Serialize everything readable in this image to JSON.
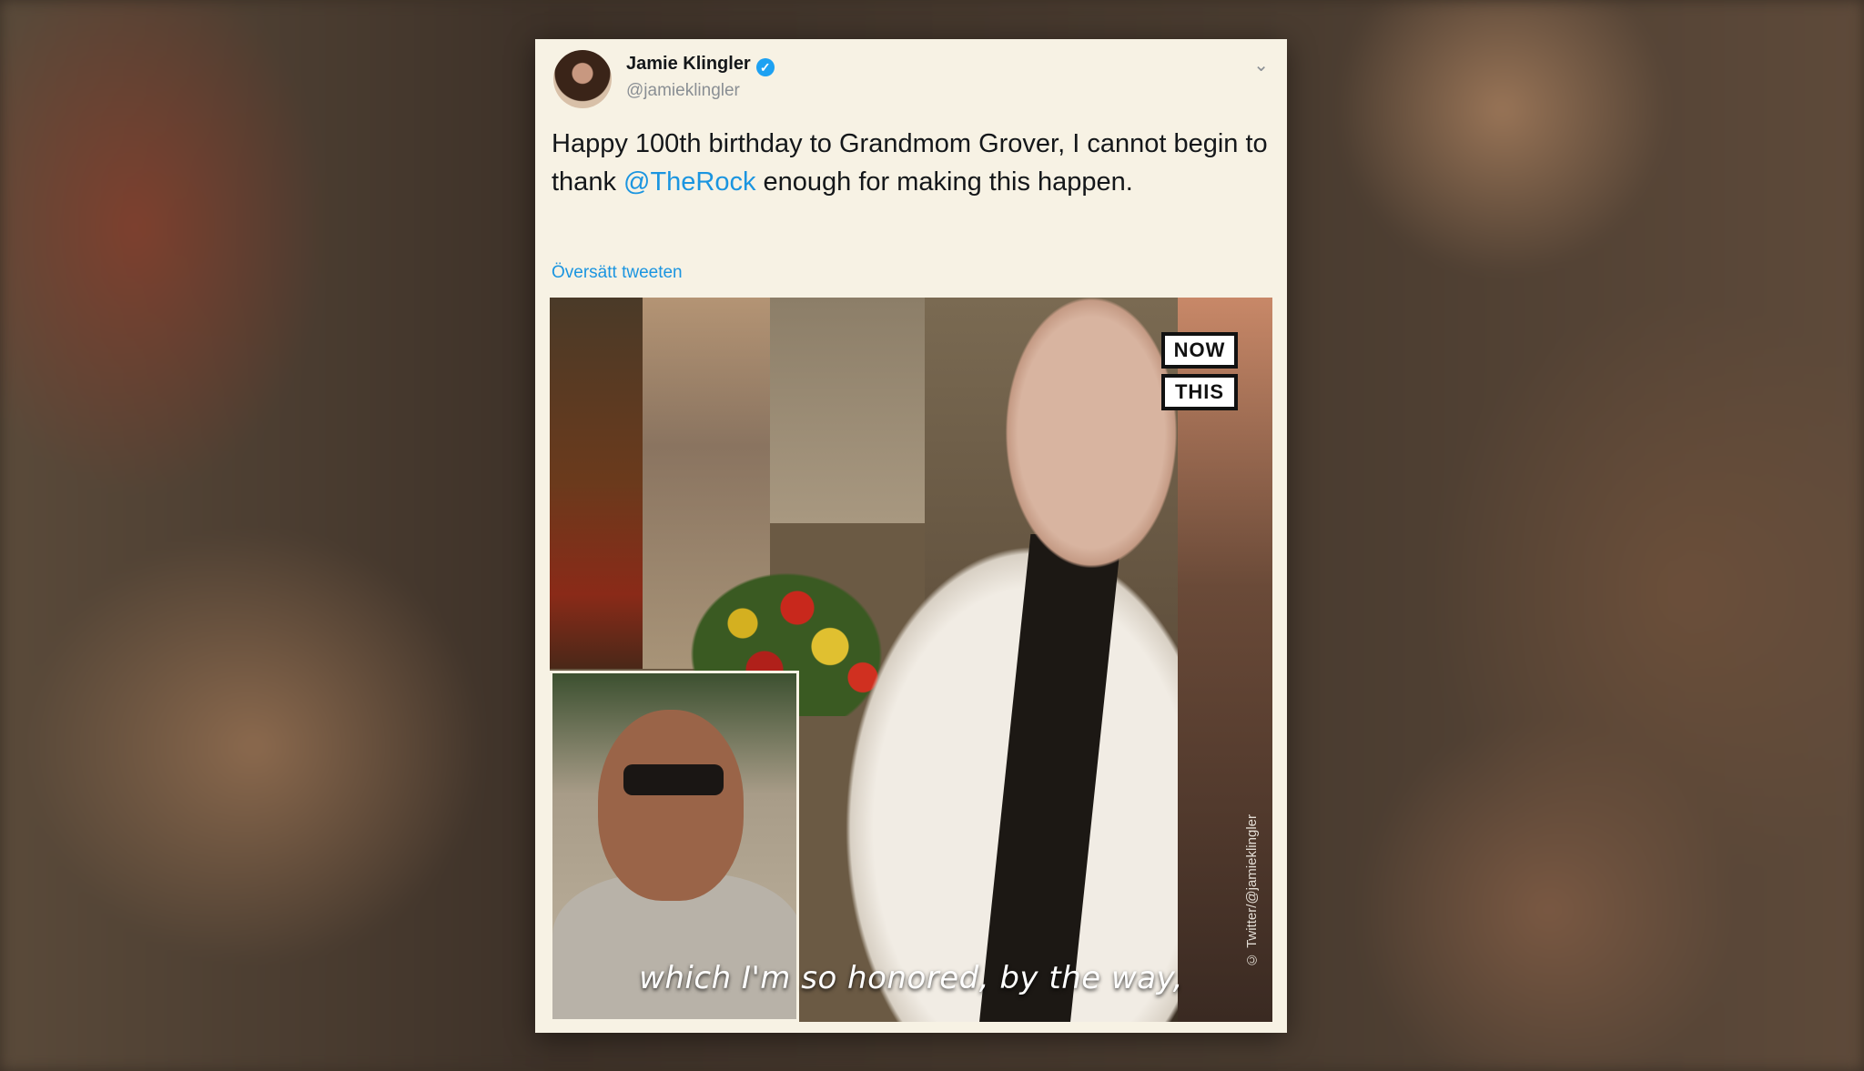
{
  "tweet": {
    "author_name": "Jamie Klingler",
    "author_handle": "@jamieklingler",
    "verified_icon": "verified-badge-icon",
    "text_before_mention": "Happy 100th birthday to Grandmom Grover, I cannot begin to thank ",
    "mention": "@TheRock",
    "text_after_mention": " enough for making this happen.",
    "translate_label": "Översätt tweeten",
    "menu_icon": "chevron-down-icon"
  },
  "media": {
    "logo_line1": "NOW",
    "logo_line2": "THIS",
    "credit": "© Twitter/@jamieklingler",
    "subtitle": "which I'm so honored, by the way,"
  },
  "colors": {
    "link": "#1b95e0",
    "card_background": "#f7f2e4",
    "verified": "#1da1f2"
  }
}
